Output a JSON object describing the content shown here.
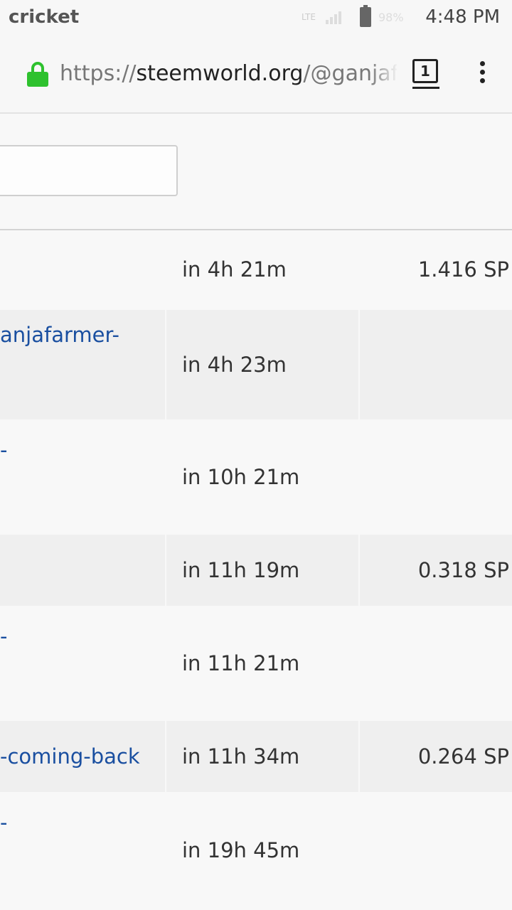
{
  "status_bar": {
    "carrier": "cricket",
    "network": "LTE",
    "battery": "98%",
    "time": "4:48 PM"
  },
  "browser": {
    "url_scheme": "https://",
    "url_host": "steemworld.org",
    "url_path": "/@ganjafa",
    "tab_count": "1",
    "icons": [
      "lock-icon",
      "tabs-icon",
      "overflow-menu-icon"
    ],
    "lock_color": "#2ec12e"
  },
  "search": {
    "value": ""
  },
  "table": {
    "link_color": "#1a4fa0",
    "rows": [
      {
        "title": "",
        "time": "in 4h 21m",
        "value": "1.416 SP"
      },
      {
        "title": "anjafarmer-",
        "time": "in 4h 23m",
        "value": ""
      },
      {
        "title": "-",
        "time": "in 10h 21m",
        "value": ""
      },
      {
        "title": "",
        "time": "in 11h 19m",
        "value": "0.318 SP"
      },
      {
        "title": "-",
        "time": "in 11h 21m",
        "value": ""
      },
      {
        "title": "-coming-back",
        "time": "in 11h 34m",
        "value": "0.264 SP"
      },
      {
        "title": "-",
        "time": "in 19h 45m",
        "value": ""
      }
    ]
  }
}
